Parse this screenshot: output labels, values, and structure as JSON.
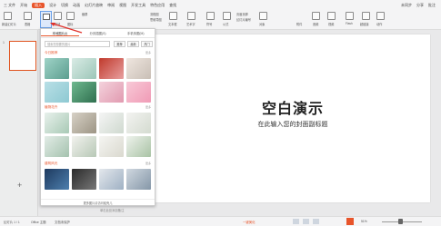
{
  "menubar": {
    "items": [
      "三 文件",
      "开始",
      "插入",
      "设计",
      "切换",
      "动画",
      "幻灯片放映",
      "审阅",
      "视图",
      "开发工具",
      "特色应用",
      "查找"
    ],
    "active": "插入",
    "right": [
      "未同步",
      "分享",
      "批注"
    ]
  },
  "ribbon": {
    "labels": [
      "新建幻灯片",
      "表格",
      "图片",
      "形状",
      "图标",
      "截屏",
      "流程图",
      "思维导图",
      "文本框",
      "艺术字",
      "符号",
      "公式",
      "页眉页脚",
      "幻灯片编号",
      "对象",
      "附件",
      "音频",
      "视频",
      "Flash",
      "超链接",
      "动作"
    ]
  },
  "popup": {
    "tabs": [
      "本地图片(I)",
      "分页插图(S)",
      "手机传图(M)"
    ],
    "search_placeholder": "搜索您想要的图片",
    "buttons": [
      "推荐",
      "最新",
      "热门"
    ],
    "sections": [
      "今日推荐",
      "植物花卉",
      "建筑风光"
    ],
    "more": "更多",
    "footer": "更多图片请访问稻壳儿"
  },
  "slide": {
    "title": "空白演示",
    "subtitle": "在此输入您的封面副标题"
  },
  "left_panel": {
    "thumb_num": "1",
    "add": "+"
  },
  "statusbar": {
    "left": "幻灯片 1 / 1",
    "theme": "Office 主题",
    "doc_protect": "文档未保护",
    "notes": "单击此处添加备注",
    "zoom": "51%",
    "beautify": "一键美化"
  },
  "colors": {
    "accent": "#e8552b",
    "selection": "#6aa0e8"
  }
}
